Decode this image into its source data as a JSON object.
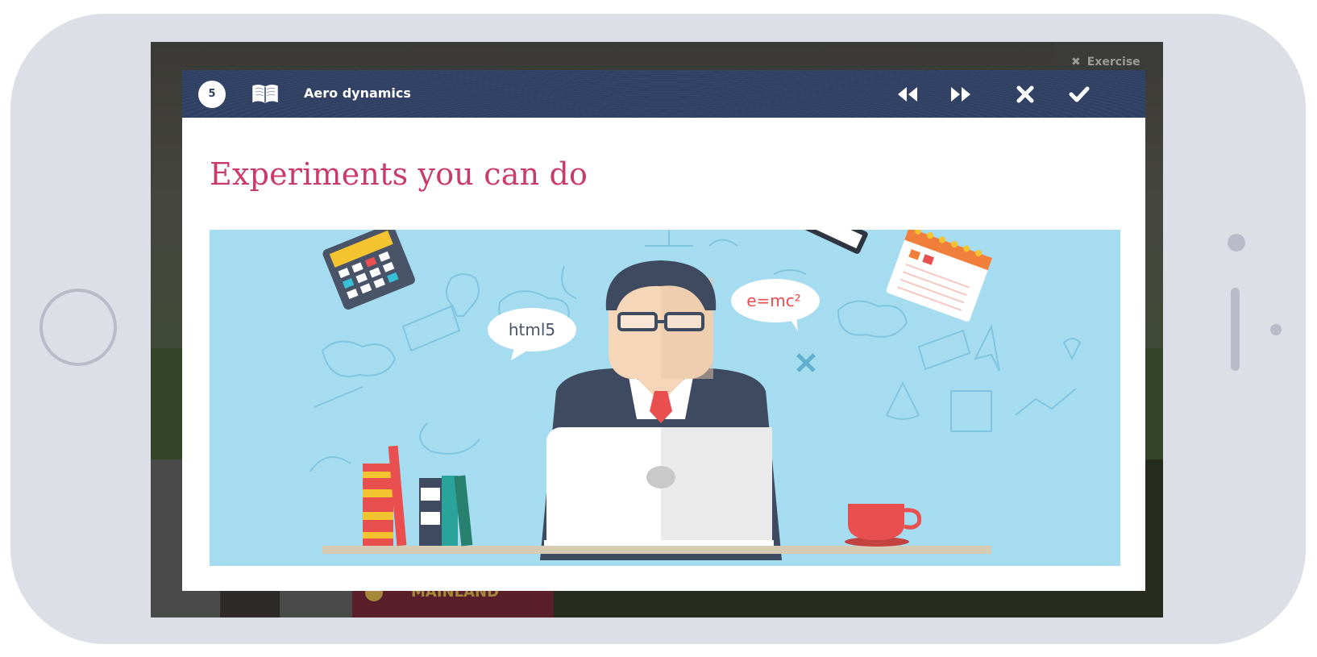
{
  "modal": {
    "step_number": "5",
    "title": "Aero dynamics",
    "content_title": "Experiments you can do"
  },
  "illustration": {
    "bubble_left": "html5",
    "bubble_right": "e=mc²"
  },
  "background": {
    "exercise_label": "Exercise",
    "mainland_label": "MAINLAND"
  },
  "colors": {
    "header": "#2f4063",
    "title_accent": "#c93b6c",
    "illustration_bg": "#a6dcef",
    "phone_frame": "#dcdfe6"
  },
  "icons": [
    "book-icon",
    "rewind-icon",
    "fast-forward-icon",
    "close-icon",
    "check-icon"
  ]
}
